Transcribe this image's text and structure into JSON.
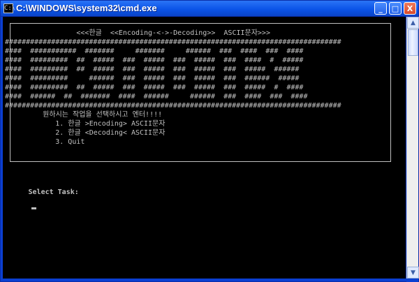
{
  "window": {
    "title": "C:\\WINDOWS\\system32\\cmd.exe",
    "icon_text": "C:\\"
  },
  "titlebar_buttons": {
    "minimize": "_",
    "maximize": "□",
    "close": "X"
  },
  "console": {
    "lines": [
      "                 <<<한글  <<Encoding-<->-Decoding>>  ASCII문자>>>",
      "################################################################################",
      "####  ###########  #######     #######     ######  ###  ####  ###  ####",
      "####  #########  ##  #####  ###  #####  ###  #####  ###  ####  #  #####",
      "####  #########  ##  #####  ###  #####  ###  #####  ###  #####  ######",
      "####  #########     ######  ###  #####  ###  #####  ###  ######  #####",
      "####  #########  ##  #####  ###  #####  ###  #####  ###  #####  #  ####",
      "####  ######  ##  #######  ####  ######     ######  ###  ####  ###  ####",
      "################################################################################",
      "         원하시는 작업을 선택하시고 엔터!!!!",
      "            1. 한글 >Encoding> ASCII문자",
      "            2. 한글 <Decoding< ASCII문자",
      "            3. Quit"
    ],
    "prompt": "Select Task:"
  },
  "scrollbar": {
    "up": "▲",
    "down": "▼"
  }
}
